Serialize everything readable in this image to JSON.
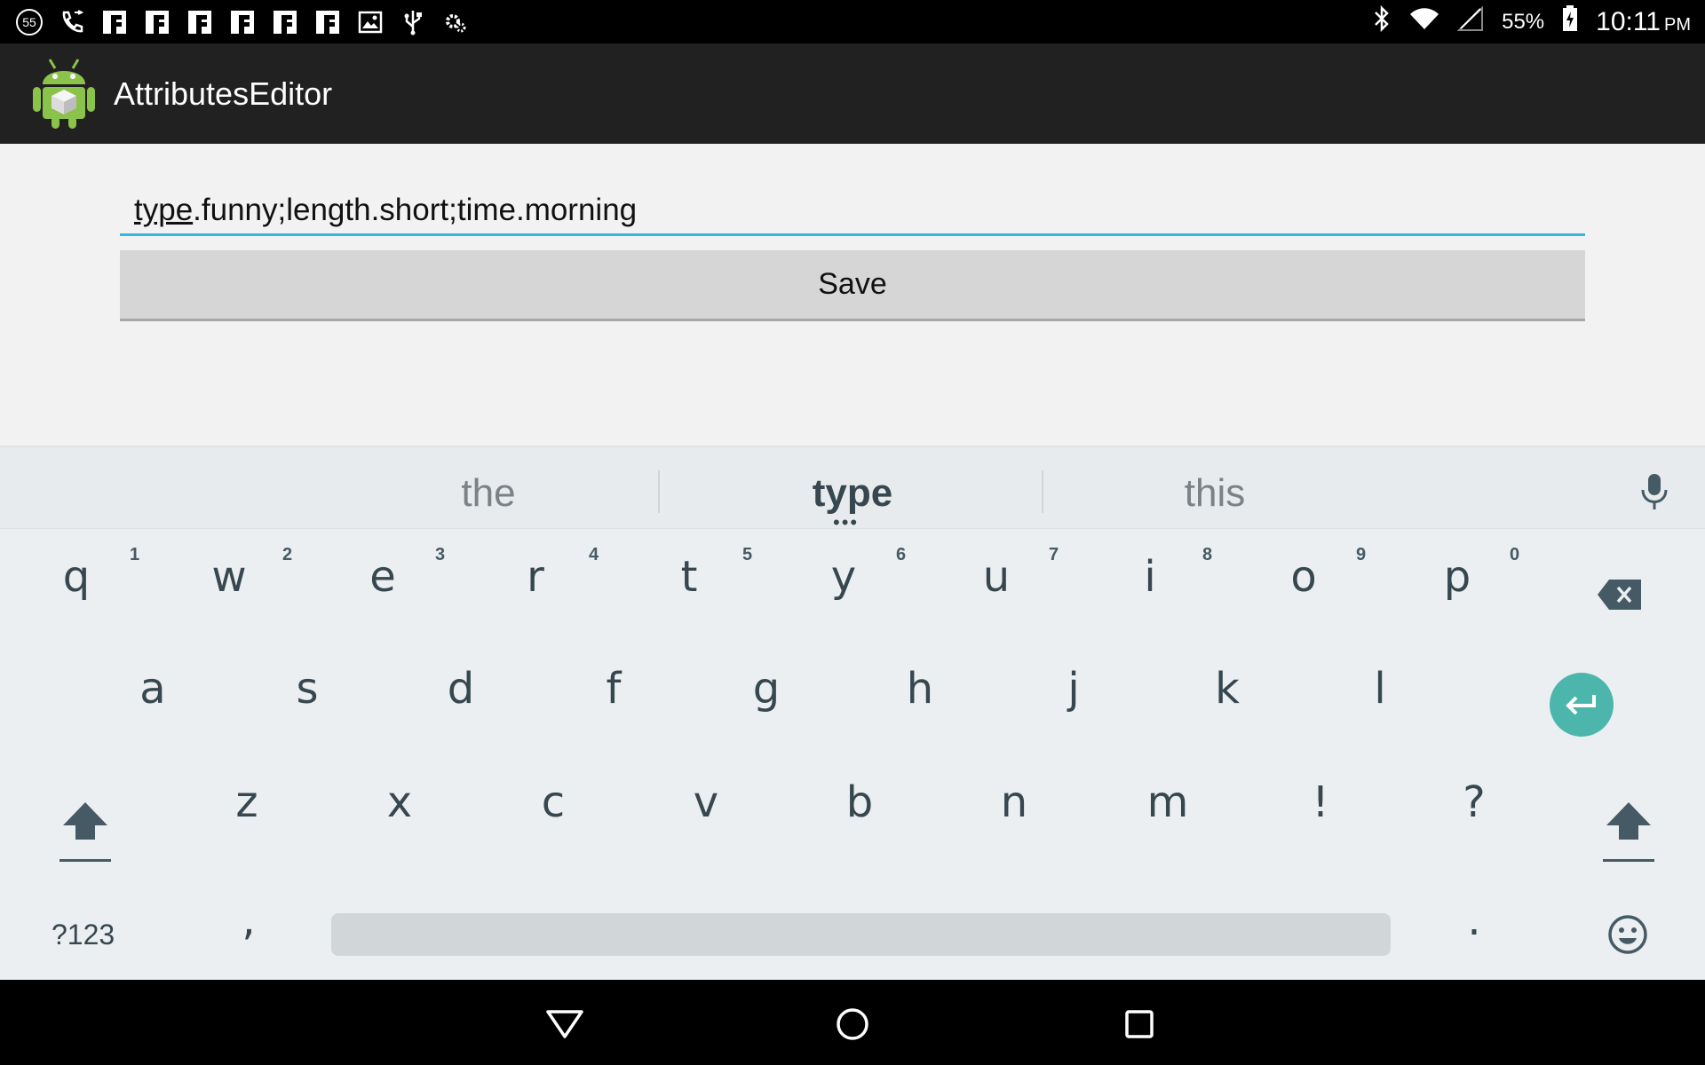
{
  "status_bar": {
    "notification_count": "55",
    "battery_percent": "55%",
    "time": "10:11",
    "ampm": "PM",
    "icons": [
      "notification-count-icon",
      "missed-call-icon",
      "flipboard-icon",
      "flipboard-icon",
      "flipboard-icon",
      "flipboard-icon",
      "flipboard-icon",
      "flipboard-icon",
      "image-icon",
      "usb-icon",
      "settings-icon",
      "bluetooth-icon",
      "wifi-icon",
      "no-signal-icon",
      "battery-charging-icon"
    ]
  },
  "app_bar": {
    "title": "AttributesEditor",
    "logo": "android-logo-icon"
  },
  "editor": {
    "value_underlined": "type",
    "value_rest": ".funny;length.short;time.morning",
    "save_label": "Save"
  },
  "keyboard": {
    "suggestions": [
      "the",
      "type",
      "this"
    ],
    "row1": [
      {
        "key": "q",
        "hint": "1"
      },
      {
        "key": "w",
        "hint": "2"
      },
      {
        "key": "e",
        "hint": "3"
      },
      {
        "key": "r",
        "hint": "4"
      },
      {
        "key": "t",
        "hint": "5"
      },
      {
        "key": "y",
        "hint": "6"
      },
      {
        "key": "u",
        "hint": "7"
      },
      {
        "key": "i",
        "hint": "8"
      },
      {
        "key": "o",
        "hint": "9"
      },
      {
        "key": "p",
        "hint": "0"
      }
    ],
    "row2": [
      "a",
      "s",
      "d",
      "f",
      "g",
      "h",
      "j",
      "k",
      "l"
    ],
    "row3": [
      "z",
      "x",
      "c",
      "v",
      "b",
      "n",
      "m",
      "!",
      "?"
    ],
    "symbols_label": "?123",
    "comma": ",",
    "period": "."
  },
  "colors": {
    "accent": "#33b5e5",
    "enter_key": "#4db6ac",
    "key_text": "#37474f",
    "action_bar": "#212121"
  }
}
